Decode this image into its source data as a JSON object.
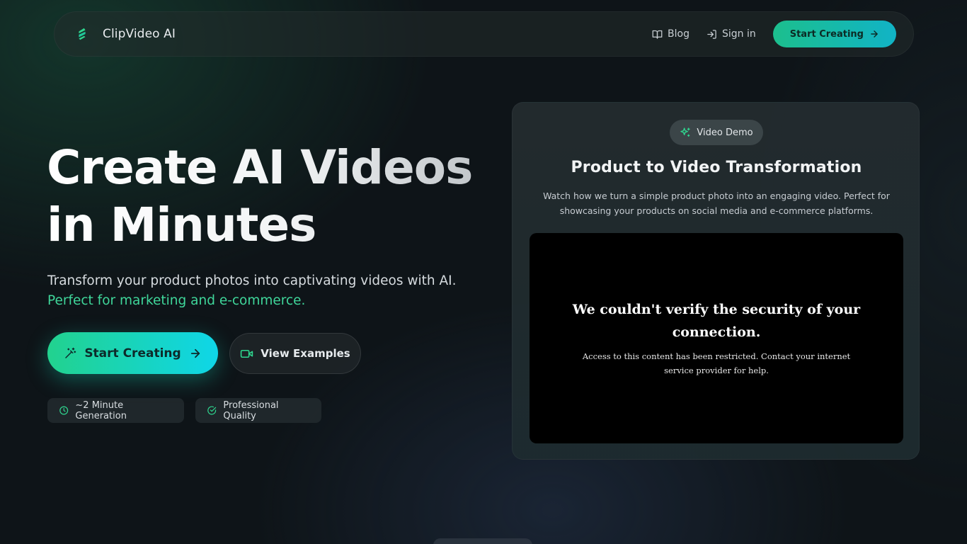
{
  "nav": {
    "brand": "ClipVideo AI",
    "blog_label": "Blog",
    "signin_label": "Sign in",
    "cta_label": "Start Creating"
  },
  "hero": {
    "title_line1": "Create AI Videos",
    "title_line2": "in Minutes",
    "subtitle": "Transform your product photos into captivating videos with AI.",
    "subtitle_accent": "Perfect for marketing and e-commerce.",
    "primary_button": "Start Creating",
    "secondary_button": "View Examples",
    "features": [
      {
        "label": "~2 Minute Generation",
        "icon": "clock-icon"
      },
      {
        "label": "Professional Quality",
        "icon": "check-circle-icon"
      }
    ]
  },
  "demo": {
    "badge": "Video Demo",
    "title": "Product to Video Transformation",
    "description": "Watch how we turn a simple product photo into an engaging video. Perfect for showcasing your products on social media and e-commerce platforms.",
    "video_error_title": "We couldn't verify the security of your connection.",
    "video_error_body": "Access to this content has been restricted. Contact your internet service provider for help."
  },
  "colors": {
    "accent_green": "#22d28e",
    "accent_cyan": "#0fd6e8",
    "accent_text": "#3fd69a",
    "background": "#0e1418"
  }
}
